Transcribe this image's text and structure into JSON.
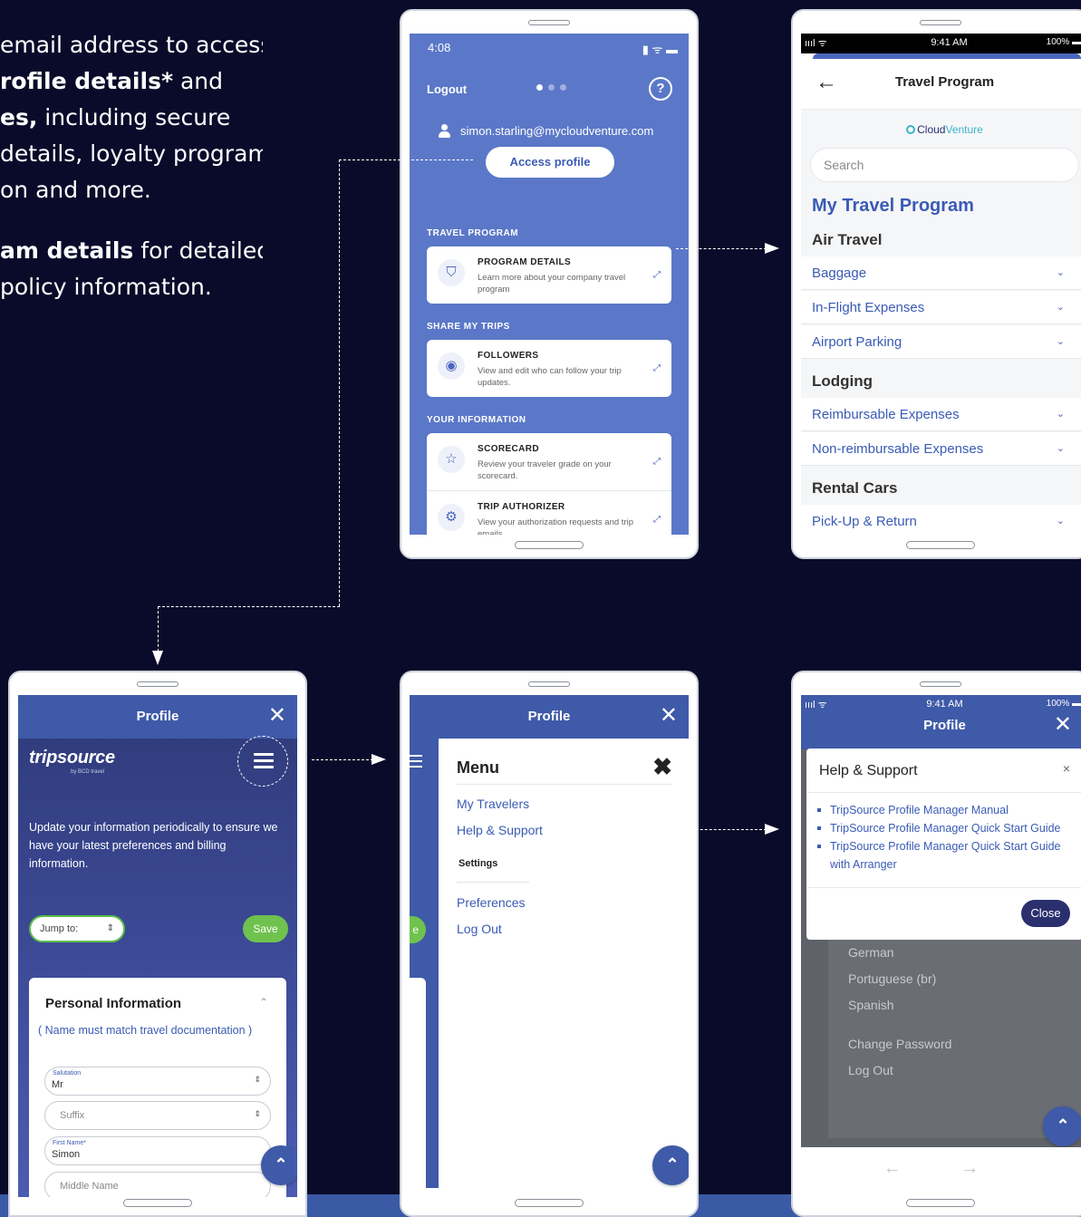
{
  "intro": {
    "lines_p1": [
      "email address to access",
      "rofile details*",
      " and",
      "es,",
      " including secure",
      "details, loyalty program",
      "on and more."
    ],
    "lines_p2": [
      "am details",
      " for detailed",
      "policy information."
    ]
  },
  "phone1": {
    "time": "4:08",
    "status_icons": "▮ ᯤ ▬",
    "logout": "Logout",
    "help_glyph": "?",
    "email": "simon.starling@mycloudventure.com",
    "access_profile": "Access profile",
    "sections": {
      "travel_program": "TRAVEL PROGRAM",
      "share_my_trips": "SHARE MY TRIPS",
      "your_information": "YOUR INFORMATION"
    },
    "cards": {
      "program_details": {
        "title": "PROGRAM DETAILS",
        "desc": "Learn more about your company travel program",
        "icon": "shield-check-icon"
      },
      "followers": {
        "title": "FOLLOWERS",
        "desc": "View and edit who can follow your trip updates.",
        "icon": "eye-icon"
      },
      "scorecard": {
        "title": "SCORECARD",
        "desc": "Review your traveler grade on your scorecard.",
        "icon": "star-icon"
      },
      "trip_authorizer": {
        "title": "TRIP AUTHORIZER",
        "desc": "View your authorization requests and trip emails.",
        "icon": "gear-icon"
      }
    },
    "ext_glyph": "⤢"
  },
  "phone2": {
    "signal": "ıııl ᯤ",
    "time": "9:41 AM",
    "battery": "100% ▬",
    "back": "←",
    "title": "Travel Program",
    "logo_a": "Cloud",
    "logo_b": "Venture",
    "search_placeholder": "Search",
    "heading": "My Travel Program",
    "groups": {
      "air": "Air Travel",
      "lodging": "Lodging",
      "rental": "Rental Cars"
    },
    "items": {
      "baggage": "Baggage",
      "inflight": "In-Flight Expenses",
      "parking": "Airport Parking",
      "reimb": "Reimbursable Expenses",
      "nonreimb": "Non-reimbursable Expenses",
      "pickup": "Pick-Up & Return"
    },
    "chevron": "⌄"
  },
  "phone3": {
    "title": "Profile",
    "close": "✕",
    "logo": "tripsource",
    "logo_sub": "by BCD travel",
    "intro": "Update your information periodically to ensure we have your latest preferences and billing information.",
    "jump_to": "Jump to:",
    "jump_arrow": "⇕",
    "save": "Save",
    "section_title": "Personal Information",
    "caret": "⌃",
    "note": "( Name must match travel documentation )",
    "fields": {
      "salutation_label": "Salutation",
      "salutation_value": "Mr",
      "suffix_placeholder": "Suffix",
      "first_label": "First Name*",
      "first_value": "Simon",
      "middle_placeholder": "Middle Name"
    },
    "up": "⌃"
  },
  "phone4": {
    "title": "Profile",
    "close": "✕",
    "save_peek": "e",
    "menu_title": "Menu",
    "menu_close": "✖",
    "items": {
      "my_travelers": "My Travelers",
      "help_support": "Help & Support",
      "settings": "Settings",
      "preferences": "Preferences",
      "log_out": "Log Out"
    },
    "up": "⌃"
  },
  "phone5": {
    "signal": "ıııl ᯤ",
    "time": "9:41 AM",
    "battery": "100% ▬",
    "title": "Profile",
    "close": "✕",
    "modal": {
      "title": "Help & Support",
      "close_x": "×",
      "links": [
        "TripSource Profile Manager Manual",
        "TripSource Profile Manager Quick Start Guide",
        "TripSource Profile Manager Quick Start Guide with Arranger"
      ],
      "close_button": "Close"
    },
    "background_items": {
      "german": "German",
      "portuguese": "Portuguese (br)",
      "spanish": "Spanish",
      "change_password": "Change Password",
      "log_out": "Log Out"
    },
    "arrows": "← →",
    "up": "⌃"
  }
}
